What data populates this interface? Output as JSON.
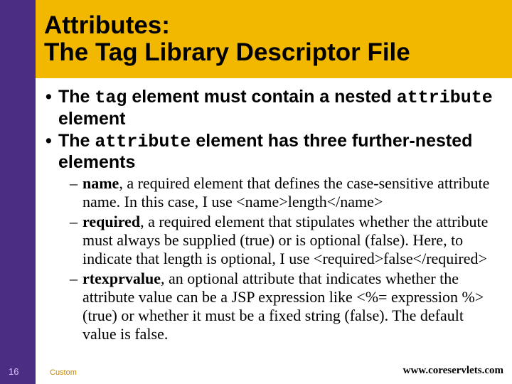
{
  "header": {
    "title_line1": "Attributes:",
    "title_line2": "The Tag Library Descriptor File"
  },
  "bullets": {
    "b1_pre": "The ",
    "b1_code1": "tag",
    "b1_mid": " element must contain a nested ",
    "b1_code2": "attribute",
    "b1_post": " element",
    "b2_pre": "The ",
    "b2_code1": "attribute",
    "b2_post": " element has three further-nested elements"
  },
  "sub": {
    "s1_name": "name",
    "s1_rest": ", a required element that defines the case-sensitive attribute name. In this case, I use <name>length</name>",
    "s2_name": "required",
    "s2_rest": ", a required element that stipulates whether the attribute must always be supplied (true) or is optional (false). Here, to indicate that length is optional, I use <required>false</required>",
    "s3_name": "rtexprvalue",
    "s3_rest": ", an optional attribute that indicates whether the attribute value can be a JSP expression like <%= expression %> (true) or whether it must be a fixed string (false). The default value is false."
  },
  "footer": {
    "page_number": "16",
    "custom": "Custom",
    "site": "www.coreservlets.com"
  }
}
